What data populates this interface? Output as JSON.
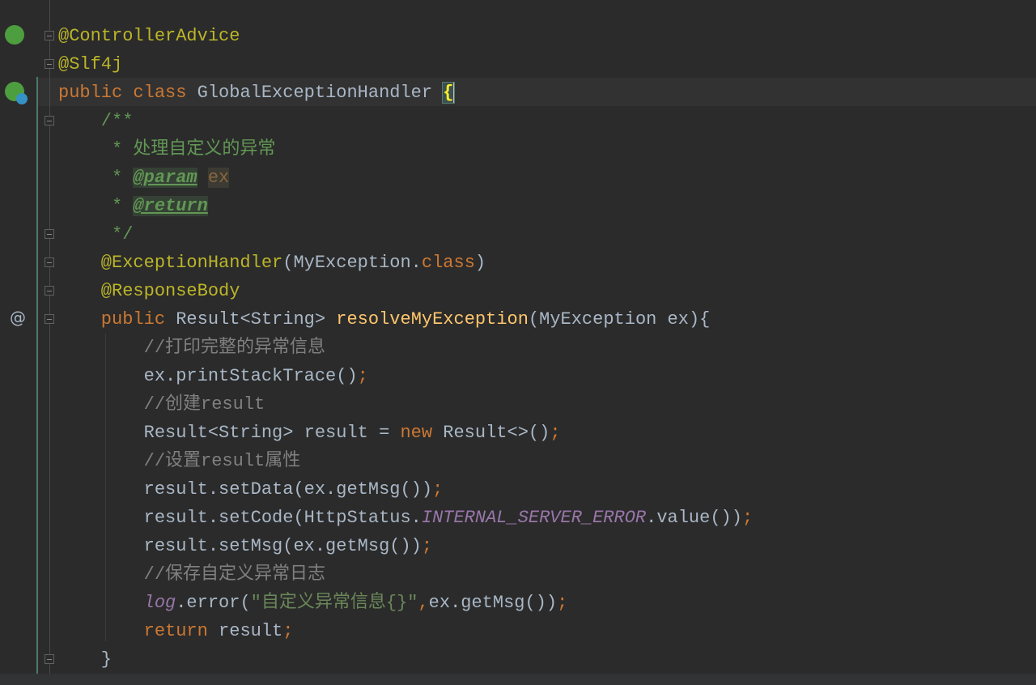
{
  "gutter": {
    "at_marker": "@"
  },
  "lines": [
    [
      [
        "ann",
        "@ControllerAdvice"
      ]
    ],
    [
      [
        "ann",
        "@Slf4j"
      ]
    ],
    [
      [
        "kw",
        "public class "
      ],
      [
        "pl",
        "GlobalExceptionHandler "
      ],
      [
        "brace",
        "{"
      ]
    ],
    [
      [
        "doc",
        "    /**"
      ]
    ],
    [
      [
        "doc",
        "     * 处理自定义的异常"
      ]
    ],
    [
      [
        "doc",
        "     * "
      ],
      [
        "tag",
        "@param"
      ],
      [
        "doc",
        " "
      ],
      [
        "par",
        "ex"
      ]
    ],
    [
      [
        "doc",
        "     * "
      ],
      [
        "tag",
        "@return"
      ]
    ],
    [
      [
        "doc",
        "     */"
      ]
    ],
    [
      [
        "ann",
        "    @ExceptionHandler"
      ],
      [
        "pl",
        "(MyException."
      ],
      [
        "kw",
        "class"
      ],
      [
        "pl",
        ")"
      ]
    ],
    [
      [
        "ann",
        "    @ResponseBody"
      ]
    ],
    [
      [
        "kw",
        "    public "
      ],
      [
        "pl",
        "Result<String> "
      ],
      [
        "md",
        "resolveMyException"
      ],
      [
        "pl",
        "(MyException ex){"
      ]
    ],
    [
      [
        "cm",
        "        //打印完整的异常信息"
      ]
    ],
    [
      [
        "pl",
        "        ex.printStackTrace()"
      ],
      [
        "kw",
        ";"
      ]
    ],
    [
      [
        "cm",
        "        //创建result"
      ]
    ],
    [
      [
        "pl",
        "        Result<String> result = "
      ],
      [
        "kw",
        "new "
      ],
      [
        "pl",
        "Result<>()"
      ],
      [
        "kw",
        ";"
      ]
    ],
    [
      [
        "cm",
        "        //设置result属性"
      ]
    ],
    [
      [
        "pl",
        "        result.setData(ex.getMsg())"
      ],
      [
        "kw",
        ";"
      ]
    ],
    [
      [
        "pl",
        "        result.setCode(HttpStatus."
      ],
      [
        "st",
        "INTERNAL_SERVER_ERROR"
      ],
      [
        "pl",
        ".value())"
      ],
      [
        "kw",
        ";"
      ]
    ],
    [
      [
        "pl",
        "        result.setMsg(ex.getMsg())"
      ],
      [
        "kw",
        ";"
      ]
    ],
    [
      [
        "cm",
        "        //保存自定义异常日志"
      ]
    ],
    [
      [
        "lg",
        "        log"
      ],
      [
        "pl",
        ".error("
      ],
      [
        "str",
        "\"自定义异常信息{}\""
      ],
      [
        "kw",
        ","
      ],
      [
        "pl",
        "ex.getMsg())"
      ],
      [
        "kw",
        ";"
      ]
    ],
    [
      [
        "kw",
        "        return "
      ],
      [
        "pl",
        "result"
      ],
      [
        "kw",
        ";"
      ]
    ],
    [
      [
        "pl",
        "    }"
      ]
    ]
  ]
}
